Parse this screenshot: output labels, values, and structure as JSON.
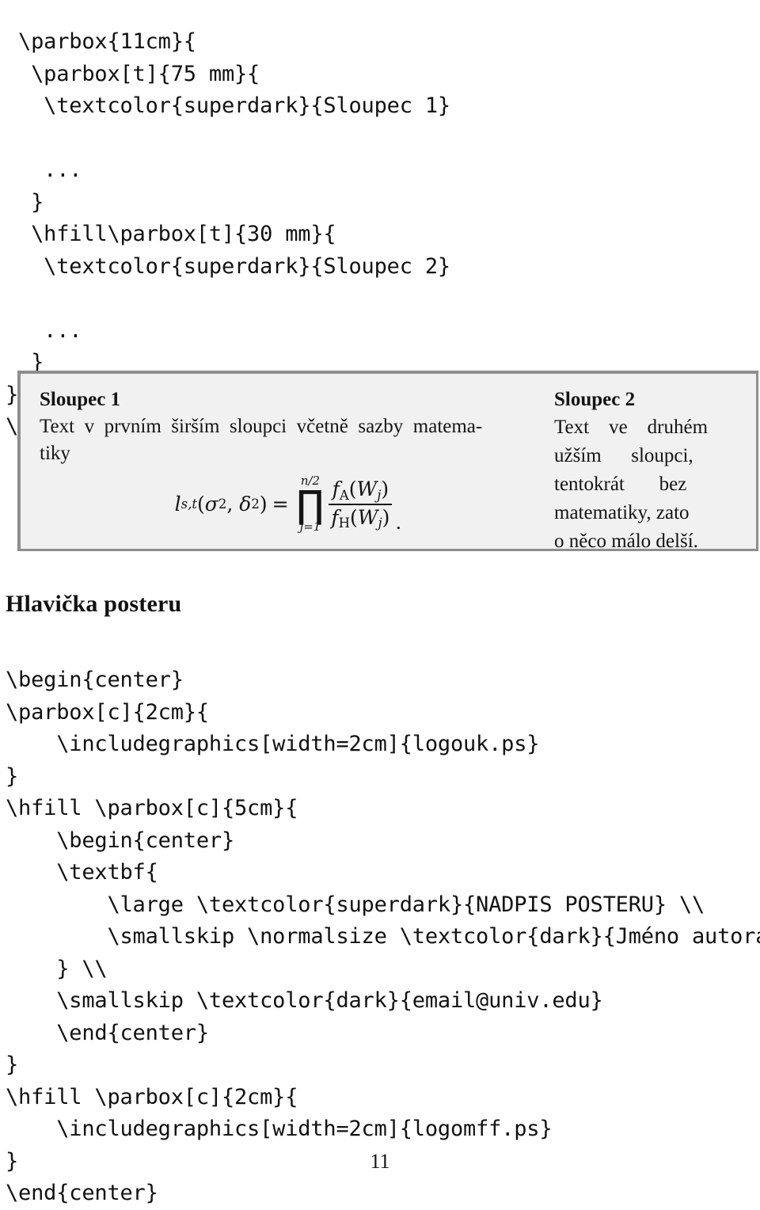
{
  "document": {
    "page_number": "11"
  },
  "code_top": {
    "lines": [
      " \\parbox{11cm}{",
      "  \\parbox[t]{75 mm}{",
      "   \\textcolor{superdark}{Sloupec 1}",
      "",
      "   ...",
      "  }",
      "  \\hfill\\parbox[t]{30 mm}{",
      "   \\textcolor{superdark}{Sloupec 2}",
      "",
      "   ...",
      "  }",
      "}}",
      "\\end{center}"
    ]
  },
  "example": {
    "column1": {
      "title": "Sloupec 1",
      "text": "Text v prvním širším sloupci včetně sazby matema-tiky",
      "formula": {
        "lhs_var": "l",
        "lhs_sub": "s,t",
        "lhs_args": "(σ2, δ2)",
        "equals": "=",
        "operator": "∏",
        "upper_limit": "n/2",
        "lower_limit": "j=1",
        "numerator": "fA(Wj)",
        "denominator": "fH(Wj)",
        "terminator": ".",
        "latex": "l_{s,t}(\\sigma^2,\\delta^2) = \\prod_{j=1}^{n/2} \\frac{f_A(W_j)}{f_H(W_j)}."
      }
    },
    "column2": {
      "title": "Sloupec 2",
      "text": "Text ve druhém užším sloupci, tentokrát bez matematiky, zato o něco málo delší."
    },
    "colors": {
      "background": "#f1f1f1",
      "border": "#8e8e8e",
      "text": "#141414"
    }
  },
  "section": {
    "heading": "Hlavička posteru"
  },
  "code_bottom": {
    "lines": [
      "\\begin{center}",
      "\\parbox[c]{2cm}{",
      "    \\includegraphics[width=2cm]{logouk.ps}",
      "}",
      "\\hfill \\parbox[c]{5cm}{",
      "    \\begin{center}",
      "    \\textbf{",
      "        \\large \\textcolor{superdark}{NADPIS POSTERU} \\\\",
      "        \\smallskip \\normalsize \\textcolor{dark}{Jméno autora}",
      "    } \\\\",
      "    \\smallskip \\textcolor{dark}{email@univ.edu}",
      "    \\end{center}",
      "}",
      "\\hfill \\parbox[c]{2cm}{",
      "    \\includegraphics[width=2cm]{logomff.ps}",
      "}",
      "\\end{center}"
    ]
  }
}
